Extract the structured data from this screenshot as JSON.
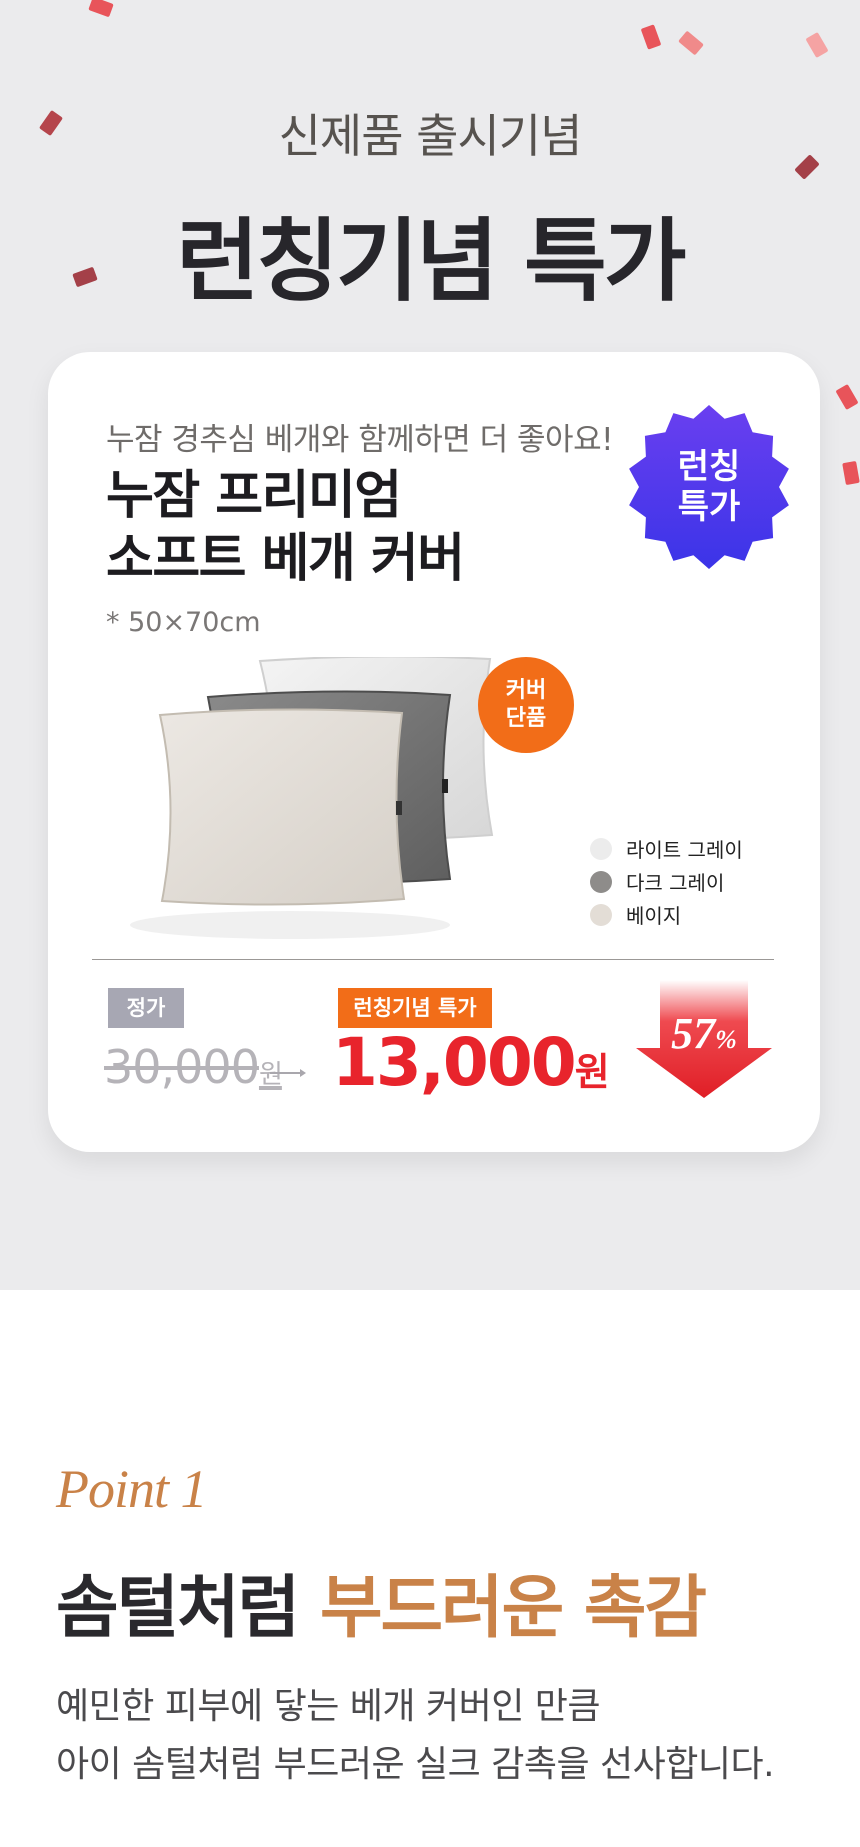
{
  "header": {
    "subtitle": "신제품 출시기념",
    "title": "런칭기념 특가"
  },
  "card": {
    "subtitle": "누잠 경추심 베개와 함께하면 더 좋아요!",
    "product_name_line1": "누잠 프리미엄",
    "product_name_line2": "소프트 베개 커버",
    "size": "* 50×70cm",
    "burst_line1": "런칭",
    "burst_line2": "특가",
    "cover_badge_line1": "커버",
    "cover_badge_line2": "단품",
    "colors": [
      {
        "label": "라이트 그레이",
        "color": "#ececec"
      },
      {
        "label": "다크 그레이",
        "color": "#8e8c8a"
      },
      {
        "label": "베이지",
        "color": "#e3ddd6"
      }
    ],
    "regular_tag": "정가",
    "launch_tag": "런칭기념 특가",
    "original_price": "30,000",
    "original_unit": "원",
    "sale_price": "13,000",
    "sale_unit": "원",
    "discount_value": "57",
    "discount_unit": "%"
  },
  "point": {
    "label": "Point 1",
    "heading_plain": "솜털처럼",
    "heading_accent": "부드러운 촉감",
    "desc_line1": "예민한 피부에 닿는 베개 커버인 만큼",
    "desc_line2": "아이 솜털처럼 부드러운 실크 감촉을 선사합니다."
  },
  "theme": {
    "background": "#ebebed",
    "accent_orange": "#f26d18",
    "sale_red": "#e8242c",
    "burst_purple": "#4a3cf0",
    "point_gold": "#c98248"
  }
}
